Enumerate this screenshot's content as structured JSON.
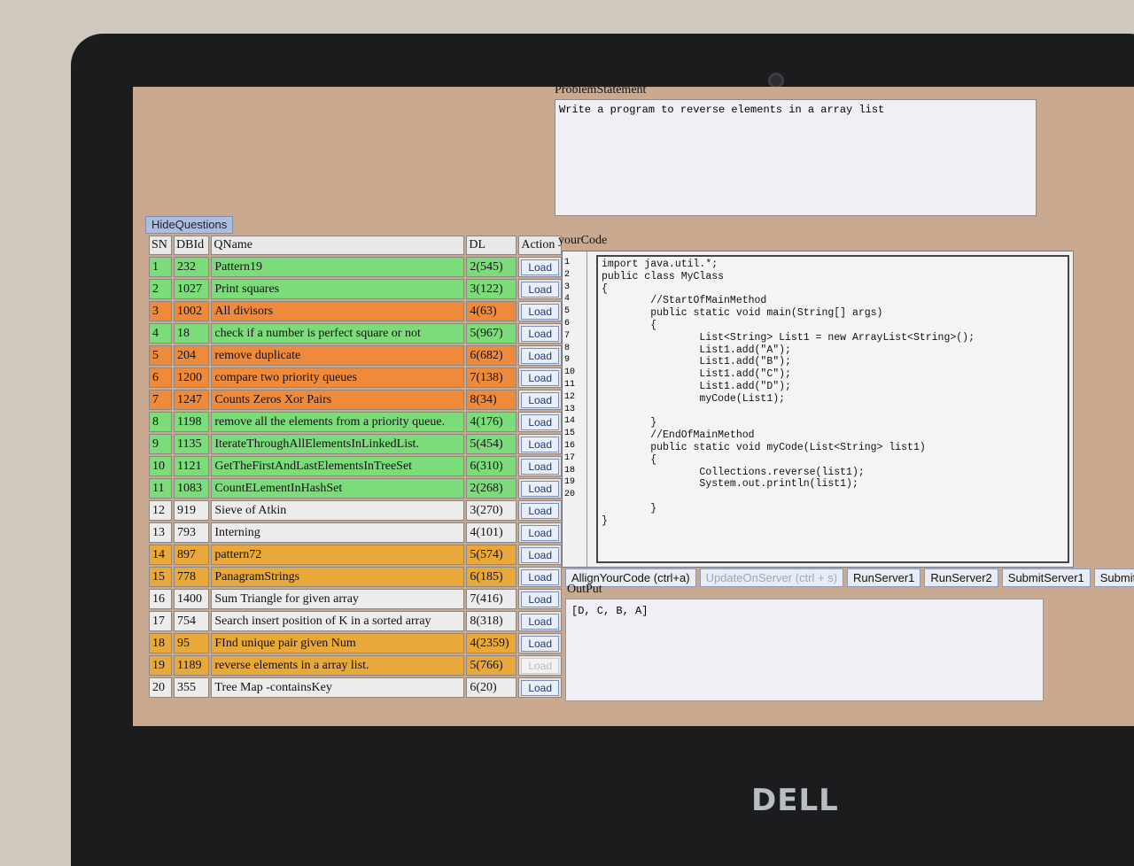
{
  "brand": "DELL",
  "hide_questions_label": "HideQuestions",
  "columns": [
    "SN",
    "DBId",
    "QName",
    "DL",
    "Action"
  ],
  "load_label": "Load",
  "rows": [
    {
      "sn": "1",
      "dbid": "232",
      "qname": "Pattern19",
      "dl": "2(545)",
      "color": "green"
    },
    {
      "sn": "2",
      "dbid": "1027",
      "qname": "Print squares",
      "dl": "3(122)",
      "color": "green"
    },
    {
      "sn": "3",
      "dbid": "1002",
      "qname": "All divisors",
      "dl": "4(63)",
      "color": "orange"
    },
    {
      "sn": "4",
      "dbid": "18",
      "qname": "check if a number is perfect square or not",
      "dl": "5(967)",
      "color": "green"
    },
    {
      "sn": "5",
      "dbid": "204",
      "qname": "remove duplicate",
      "dl": "6(682)",
      "color": "orange"
    },
    {
      "sn": "6",
      "dbid": "1200",
      "qname": "compare two priority queues",
      "dl": "7(138)",
      "color": "orange"
    },
    {
      "sn": "7",
      "dbid": "1247",
      "qname": "Counts Zeros Xor Pairs",
      "dl": "8(34)",
      "color": "orange"
    },
    {
      "sn": "8",
      "dbid": "1198",
      "qname": "remove all the elements from a priority queue.",
      "dl": "4(176)",
      "color": "green"
    },
    {
      "sn": "9",
      "dbid": "1135",
      "qname": "IterateThroughAllElementsInLinkedList.",
      "dl": "5(454)",
      "color": "green"
    },
    {
      "sn": "10",
      "dbid": "1121",
      "qname": "GetTheFirstAndLastElementsInTreeSet",
      "dl": "6(310)",
      "color": "green"
    },
    {
      "sn": "11",
      "dbid": "1083",
      "qname": "CountELementInHashSet",
      "dl": "2(268)",
      "color": "green"
    },
    {
      "sn": "12",
      "dbid": "919",
      "qname": "Sieve of Atkin",
      "dl": "3(270)",
      "color": "white"
    },
    {
      "sn": "13",
      "dbid": "793",
      "qname": "Interning",
      "dl": "4(101)",
      "color": "white"
    },
    {
      "sn": "14",
      "dbid": "897",
      "qname": "pattern72",
      "dl": "5(574)",
      "color": "yellow"
    },
    {
      "sn": "15",
      "dbid": "778",
      "qname": "PanagramStrings",
      "dl": "6(185)",
      "color": "yellow"
    },
    {
      "sn": "16",
      "dbid": "1400",
      "qname": "Sum Triangle for given array",
      "dl": "7(416)",
      "color": "white"
    },
    {
      "sn": "17",
      "dbid": "754",
      "qname": "Search insert position of K in a sorted array",
      "dl": "8(318)",
      "color": "white"
    },
    {
      "sn": "18",
      "dbid": "95",
      "qname": "FInd unique pair given Num",
      "dl": "4(2359)",
      "color": "yellow"
    },
    {
      "sn": "19",
      "dbid": "1189",
      "qname": "reverse elements in a array list.",
      "dl": "5(766)",
      "color": "yellow",
      "disabled": true
    },
    {
      "sn": "20",
      "dbid": "355",
      "qname": "Tree Map -containsKey",
      "dl": "6(20)",
      "color": "white"
    }
  ],
  "problem": {
    "label": "ProblemStatement",
    "text": "Write a program to reverse elements in a array list"
  },
  "code": {
    "label": "yourCode",
    "line_numbers": [
      "1",
      "2",
      "3",
      "4",
      "5",
      "6",
      "7",
      "8",
      "9",
      "10",
      "11",
      "12",
      "13",
      "14",
      "15",
      "16",
      "17",
      "18",
      "19",
      "20"
    ],
    "text": "import java.util.*;\npublic class MyClass\n{\n        //StartOfMainMethod\n        public static void main(String[] args)\n        {\n                List<String> List1 = new ArrayList<String>();\n                List1.add(\"A\");\n                List1.add(\"B\");\n                List1.add(\"C\");\n                List1.add(\"D\");\n                myCode(List1);\n\n        }\n        //EndOfMainMethod\n        public static void myCode(List<String> list1)\n        {\n                Collections.reverse(list1);\n                System.out.println(list1);\n\n        }\n}"
  },
  "toolbar": {
    "align": "AllignYourCode (ctrl+a)",
    "update": "UpdateOnServer (ctrl + s)",
    "run1": "RunServer1",
    "run2": "RunServer2",
    "submit1": "SubmitServer1",
    "submit2": "SubmitServe"
  },
  "output": {
    "label": "OutPut",
    "text": "[D, C, B, A]"
  }
}
